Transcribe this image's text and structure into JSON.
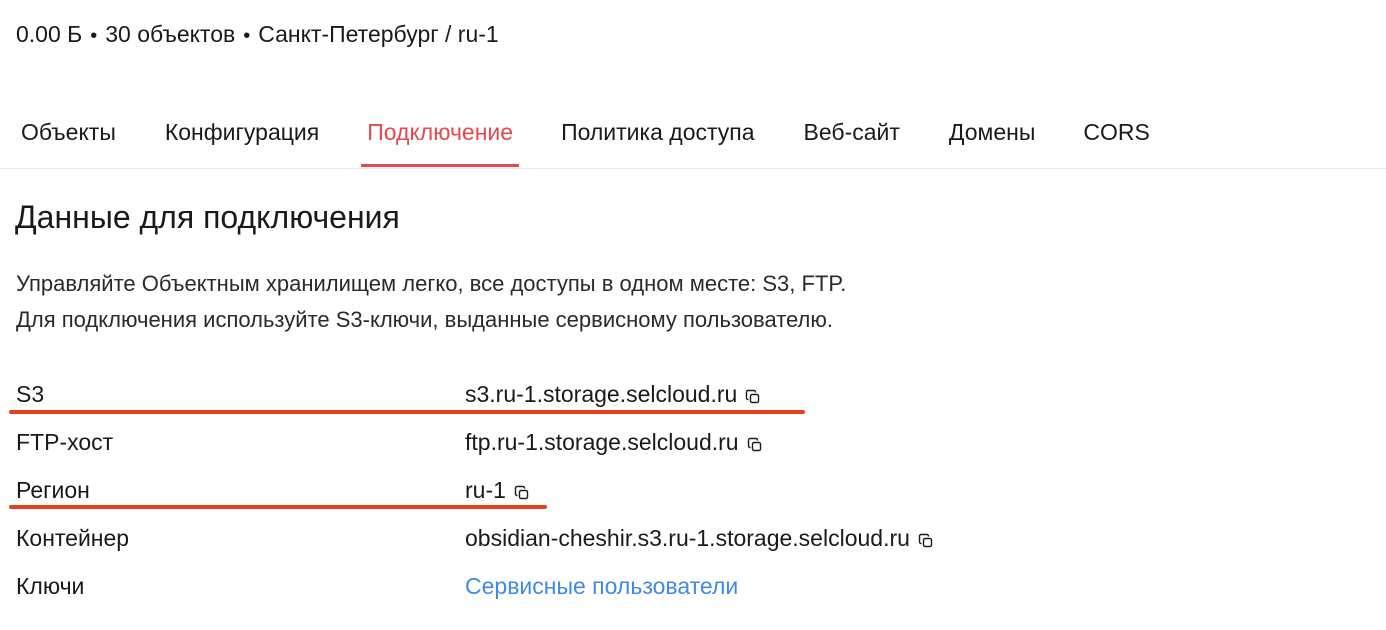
{
  "meta": {
    "size": "0.00 Б",
    "separator": "•",
    "objects": "30 объектов",
    "location": "Санкт-Петербург / ru-1"
  },
  "tabs": [
    {
      "label": "Объекты",
      "active": false
    },
    {
      "label": "Конфигурация",
      "active": false
    },
    {
      "label": "Подключение",
      "active": true
    },
    {
      "label": "Политика доступа",
      "active": false
    },
    {
      "label": "Веб-сайт",
      "active": false
    },
    {
      "label": "Домены",
      "active": false
    },
    {
      "label": "CORS",
      "active": false
    }
  ],
  "section": {
    "title": "Данные для подключения",
    "description_line1": "Управляйте Объектным хранилищем легко, все доступы в одном месте: S3, FTP.",
    "description_line2": "Для подключения используйте S3-ключи, выданные сервисному пользователю."
  },
  "connection": {
    "s3": {
      "label": "S3",
      "value": "s3.ru-1.storage.selcloud.ru"
    },
    "ftp": {
      "label": "FTP-хост",
      "value": "ftp.ru-1.storage.selcloud.ru"
    },
    "region": {
      "label": "Регион",
      "value": "ru-1"
    },
    "container": {
      "label": "Контейнер",
      "value": "obsidian-cheshir.s3.ru-1.storage.selcloud.ru"
    },
    "keys": {
      "label": "Ключи",
      "link": "Сервисные пользователи"
    }
  },
  "icons": {
    "copy": "copy-icon"
  },
  "colors": {
    "active_tab": "#e5484d",
    "link": "#3f8ae6",
    "annotation": "#e8401f"
  }
}
